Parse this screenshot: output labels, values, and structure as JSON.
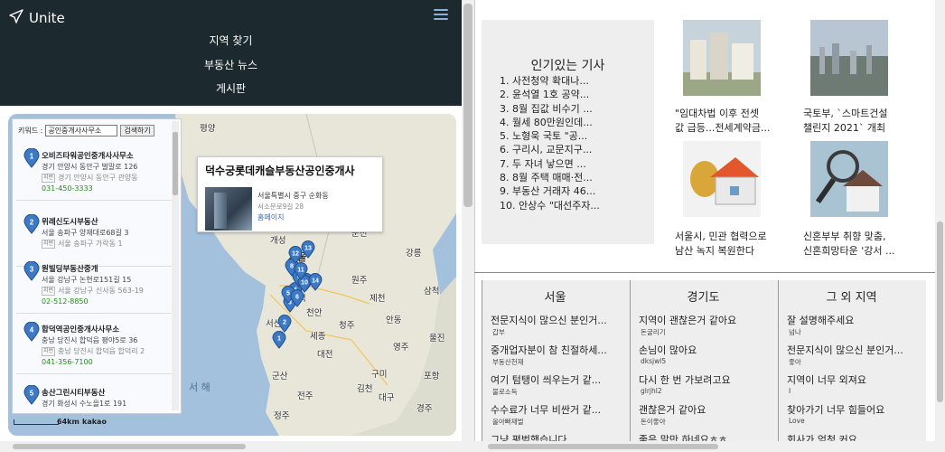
{
  "nav": {
    "brand": "Unite",
    "links": [
      "지역 찾기",
      "부동산 뉴스",
      "게시판"
    ]
  },
  "search": {
    "label": "키워드 :",
    "value": "공인중개사사무소",
    "button": "검색하기"
  },
  "results": [
    {
      "num": "1",
      "title": "오비즈타워공인중개사사무소",
      "addr": "경기 안양시 동안구 벌말로 126",
      "jibun": "경기 안양시 동안구 관양동",
      "phone": "031-450-3333"
    },
    {
      "num": "2",
      "title": "위례신도시부동산",
      "addr": "서울 송파구 양재대로68길 3",
      "jibun": "서울 송파구 가락동 1",
      "phone": ""
    },
    {
      "num": "3",
      "title": "원빌딩부동산중개",
      "addr": "서울 강남구 논현로151길 15",
      "jibun": "서울 강남구 신사동 563-19",
      "phone": "02-512-8850"
    },
    {
      "num": "4",
      "title": "합덕역공인중개사사무소",
      "addr": "충남 당진시 합덕읍 평야5로 36",
      "jibun": "충남 당진시 합덕읍 합덕리 2",
      "phone": "041-356-7100"
    },
    {
      "num": "5",
      "title": "송산그린시티부동산",
      "addr": "경기 화성시 수노을1로 191",
      "jibun": "",
      "phone": ""
    }
  ],
  "jibun_tag": "지번",
  "infowindow": {
    "title": "덕수궁롯데캐슬부동산공인중개사",
    "addr": "서울특별시 중구 순화동",
    "addr2": "서소문로9길 28",
    "link": "홈페이지"
  },
  "map": {
    "scale": "64km",
    "provider": "kakao",
    "labels": [
      {
        "t": "평양",
        "cls": ""
      },
      {
        "t": "개성",
        "cls": ""
      },
      {
        "t": "서울",
        "cls": "c"
      },
      {
        "t": "서산",
        "cls": ""
      },
      {
        "t": "천안",
        "cls": ""
      },
      {
        "t": "세종",
        "cls": ""
      },
      {
        "t": "대전",
        "cls": ""
      },
      {
        "t": "청주",
        "cls": ""
      },
      {
        "t": "강릉",
        "cls": ""
      },
      {
        "t": "원주",
        "cls": ""
      },
      {
        "t": "춘천",
        "cls": ""
      },
      {
        "t": "안동",
        "cls": ""
      },
      {
        "t": "대구",
        "cls": ""
      },
      {
        "t": "포항",
        "cls": ""
      },
      {
        "t": "구미",
        "cls": ""
      },
      {
        "t": "전주",
        "cls": ""
      },
      {
        "t": "군산",
        "cls": ""
      },
      {
        "t": "경주",
        "cls": ""
      },
      {
        "t": "정주",
        "cls": ""
      },
      {
        "t": "서 해",
        "cls": "sea-l"
      },
      {
        "t": "평택",
        "cls": ""
      },
      {
        "t": "제천",
        "cls": ""
      },
      {
        "t": "울진",
        "cls": ""
      },
      {
        "t": "영주",
        "cls": ""
      },
      {
        "t": "김천",
        "cls": ""
      },
      {
        "t": "삼척",
        "cls": ""
      }
    ],
    "pins": [
      "1",
      "2",
      "3",
      "4",
      "5",
      "6",
      "7",
      "8",
      "9",
      "10",
      "11",
      "12",
      "13",
      "14"
    ]
  },
  "popular": {
    "heading": "인기있는 기사",
    "items": [
      "1. 사전청약 확대나...",
      "2. 윤석열 1호 공약...",
      "3. 8월 집값 비수기 ...",
      "4. 월세 80만원인데...",
      "5. 노형욱 국토 \"공...",
      "6. 구리시, 교문지구...",
      "7. 두 자녀 낳으면 ...",
      "8. 8월 주택 매매·전...",
      "9. 부동산 거래자 46...",
      "10. 안상수 \"대선주자..."
    ]
  },
  "news": [
    {
      "line1": "\"임대차법 이후 전셋",
      "line2": "값 급등...전세계약금..."
    },
    {
      "line1": "국토부, `스마트건설",
      "line2": "챌린지 2021` 개최"
    },
    {
      "line1": "서울시, 민관 협력으로",
      "line2": "남산 녹지 복원한다"
    },
    {
      "line1": "신혼부부 취향 맞춤,",
      "line2": "신혼희망타운 '강서 ..."
    }
  ],
  "board": [
    {
      "heading": "서울",
      "posts": [
        {
          "q": "전문지식이 많으신 분인거...",
          "u": "갑부"
        },
        {
          "q": "중개업자분이 참 친절하세...",
          "u": "부동산천재"
        },
        {
          "q": "여기 텀탱이 씌우는거 같...",
          "u": "불로소득"
        },
        {
          "q": "수수료가 너무 비싼거 같...",
          "u": "올아빠재벌"
        },
        {
          "q": "그냥 평범했습니다",
          "u": ""
        }
      ]
    },
    {
      "heading": "경기도",
      "posts": [
        {
          "q": "지역이 괜찮은거 같아요",
          "u": "돈굴리기"
        },
        {
          "q": "손님이 많아요",
          "u": "dksjwl5"
        },
        {
          "q": "다시 한 번 가보려고요",
          "u": "glrjhl2"
        },
        {
          "q": "괜찮은거 같아요",
          "u": "돈이좋아"
        },
        {
          "q": "좋은 말만 하네요ㅎㅎ",
          "u": ""
        }
      ]
    },
    {
      "heading": "그 외 지역",
      "posts": [
        {
          "q": "잘 설명해주세요",
          "u": "넘나"
        },
        {
          "q": "전문지식이 많으신 분인거...",
          "u": "좋아"
        },
        {
          "q": "지역이 너무 외져요",
          "u": "I"
        },
        {
          "q": "찾아가기 너무 힘들어요",
          "u": "Love"
        },
        {
          "q": "회사가 엄청 커요",
          "u": ""
        }
      ]
    }
  ]
}
